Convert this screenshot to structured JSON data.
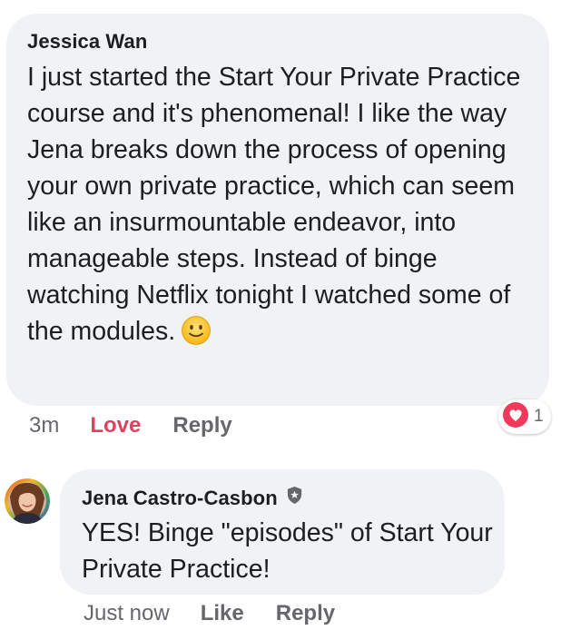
{
  "comment": {
    "author": "Jessica Wan",
    "text": "I just started the Start Your Private Practice course and it's phenomenal! I like the way Jena breaks down the process of opening your own private practice, which can seem like an insurmountable endeavor, into manageable steps. Instead of binge watching Netflix tonight I watched some of the modules.",
    "emoji": "slightly-smiling-face-icon",
    "time": "3m",
    "love_label": "Love",
    "reply_label": "Reply",
    "reaction_count": "1",
    "reaction_type": "love-reaction-icon"
  },
  "reply": {
    "author": "Jena Castro-Casbon",
    "badge": "admin-shield-icon",
    "text": "YES! Binge \"episodes\" of Start Your Private Practice!",
    "time": "Just now",
    "like_label": "Like",
    "reply_label": "Reply"
  },
  "colors": {
    "bubble": "#f0f2f5",
    "text": "#1c1e21",
    "secondary": "#65676b",
    "love": "#e3405f"
  }
}
